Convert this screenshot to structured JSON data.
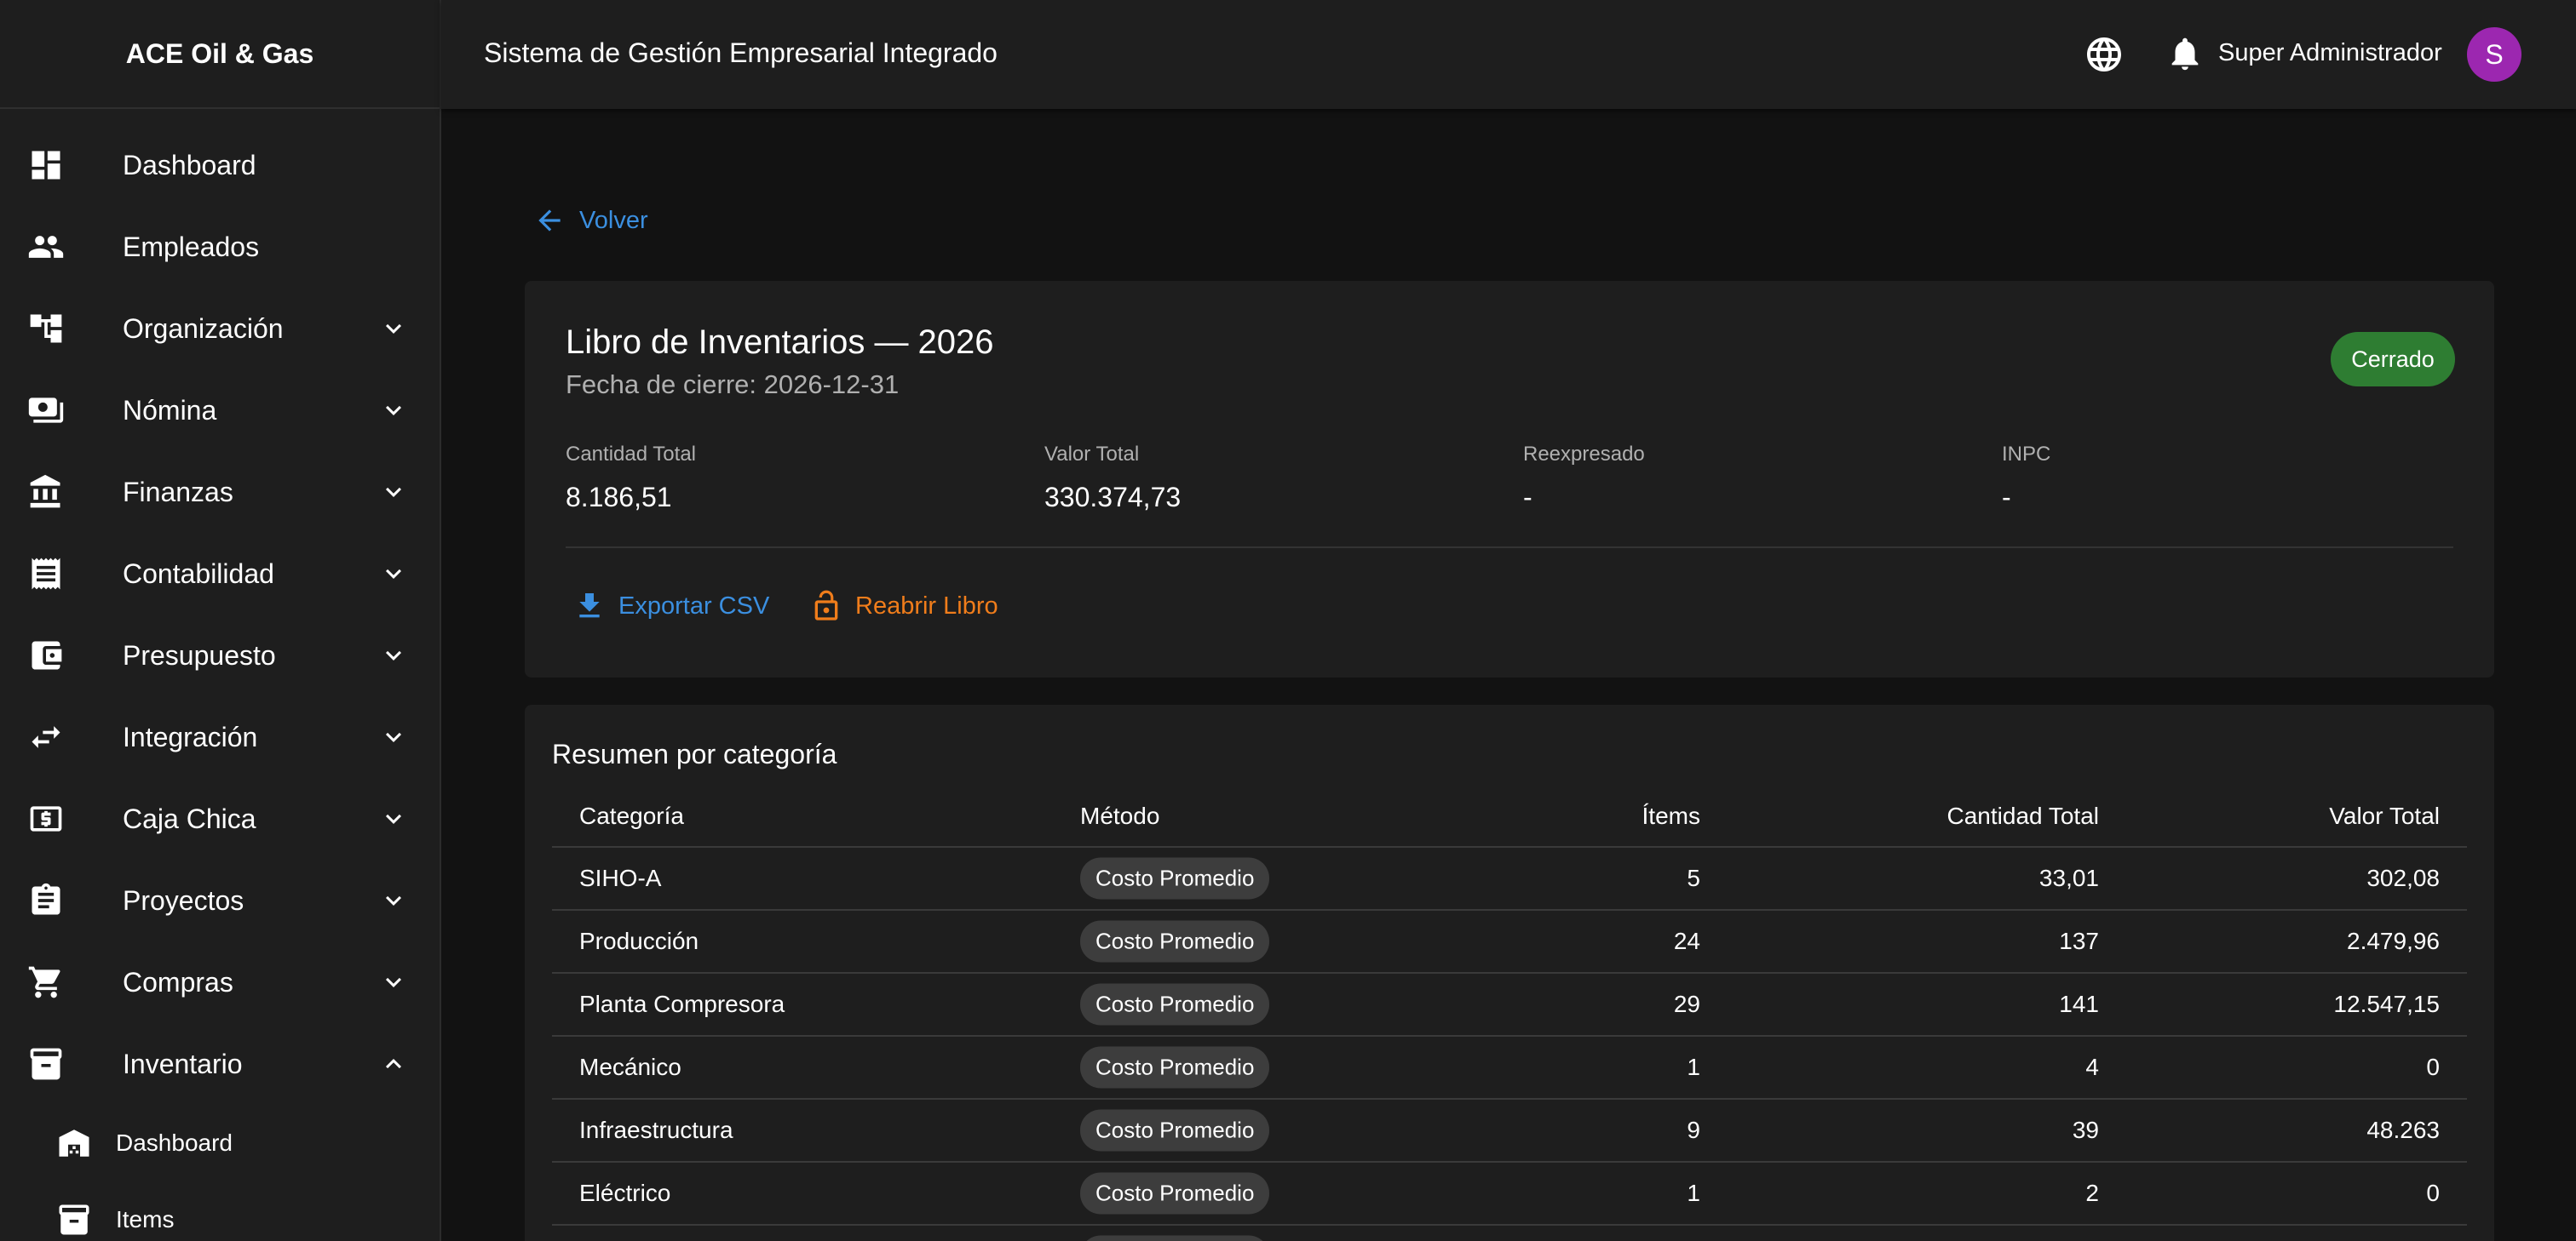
{
  "brand": "ACE Oil & Gas",
  "app_title": "Sistema de Gestión Empresarial Integrado",
  "user": {
    "name": "Super Administrador",
    "initial": "S",
    "avatar_color": "#9c27b0"
  },
  "topbar_icons": [
    "globe-icon",
    "bell-icon"
  ],
  "sidebar": {
    "items": [
      {
        "label": "Dashboard",
        "icon": "dashboard-icon",
        "expandable": false
      },
      {
        "label": "Empleados",
        "icon": "people-icon",
        "expandable": false
      },
      {
        "label": "Organización",
        "icon": "account-tree-icon",
        "expandable": true,
        "expanded": false
      },
      {
        "label": "Nómina",
        "icon": "payments-icon",
        "expandable": true,
        "expanded": false
      },
      {
        "label": "Finanzas",
        "icon": "bank-icon",
        "expandable": true,
        "expanded": false
      },
      {
        "label": "Contabilidad",
        "icon": "receipt-icon",
        "expandable": true,
        "expanded": false
      },
      {
        "label": "Presupuesto",
        "icon": "wallet-icon",
        "expandable": true,
        "expanded": false
      },
      {
        "label": "Integración",
        "icon": "swap-icon",
        "expandable": true,
        "expanded": false
      },
      {
        "label": "Caja Chica",
        "icon": "cash-icon",
        "expandable": true,
        "expanded": false
      },
      {
        "label": "Proyectos",
        "icon": "assignment-icon",
        "expandable": true,
        "expanded": false
      },
      {
        "label": "Compras",
        "icon": "cart-icon",
        "expandable": true,
        "expanded": false
      },
      {
        "label": "Inventario",
        "icon": "archive-icon",
        "expandable": true,
        "expanded": true
      }
    ],
    "sub_items": [
      {
        "label": "Dashboard",
        "icon": "warehouse-icon"
      },
      {
        "label": "Items",
        "icon": "inventory-icon"
      }
    ]
  },
  "back_label": "Volver",
  "book": {
    "title": "Libro de Inventarios — 2026",
    "closing_date": "Fecha de cierre: 2026-12-31",
    "status": "Cerrado",
    "status_color": "#2e7d32",
    "stats": [
      {
        "label": "Cantidad Total",
        "value": "8.186,51"
      },
      {
        "label": "Valor Total",
        "value": "330.374,73"
      },
      {
        "label": "Reexpresado",
        "value": "-"
      },
      {
        "label": "INPC",
        "value": "-"
      }
    ],
    "actions": {
      "export": "Exportar CSV",
      "reopen": "Reabrir Libro"
    }
  },
  "summary": {
    "title": "Resumen por categoría",
    "columns": [
      "Categoría",
      "Método",
      "Ítems",
      "Cantidad Total",
      "Valor Total"
    ],
    "rows": [
      {
        "category": "SIHO-A",
        "method": "Costo Promedio",
        "items": "5",
        "quantity": "33,01",
        "value": "302,08"
      },
      {
        "category": "Producción",
        "method": "Costo Promedio",
        "items": "24",
        "quantity": "137",
        "value": "2.479,96"
      },
      {
        "category": "Planta Compresora",
        "method": "Costo Promedio",
        "items": "29",
        "quantity": "141",
        "value": "12.547,15"
      },
      {
        "category": "Mecánico",
        "method": "Costo Promedio",
        "items": "1",
        "quantity": "4",
        "value": "0"
      },
      {
        "category": "Infraestructura",
        "method": "Costo Promedio",
        "items": "9",
        "quantity": "39",
        "value": "48.263"
      },
      {
        "category": "Eléctrico",
        "method": "Costo Promedio",
        "items": "1",
        "quantity": "2",
        "value": "0"
      }
    ]
  },
  "colors": {
    "link": "#3b8fe0",
    "warning": "#f07d1b",
    "surface": "#1e1e1e",
    "background": "#121212"
  }
}
